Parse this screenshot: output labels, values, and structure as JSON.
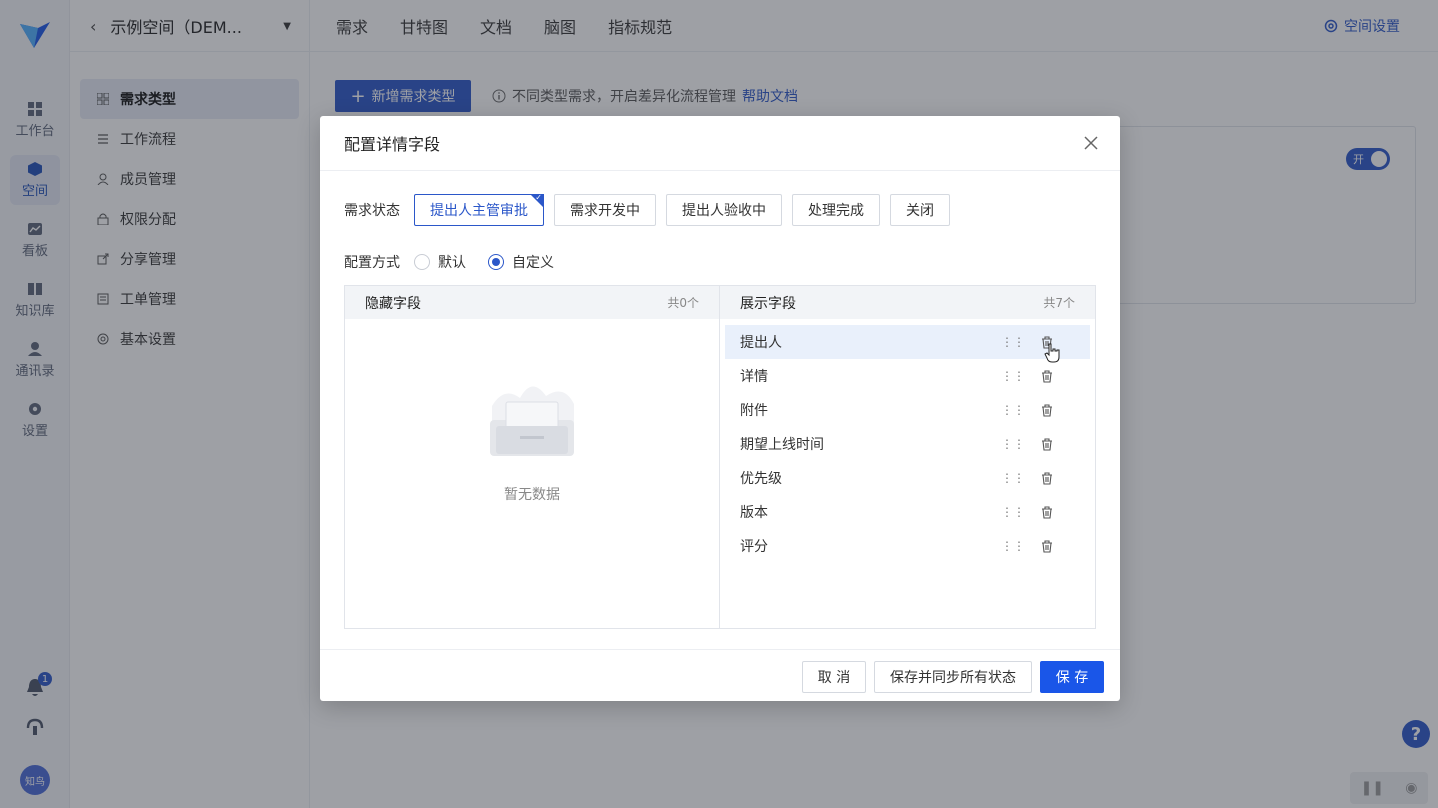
{
  "rail": {
    "items": [
      {
        "label": "工作台",
        "icon": "dashboard-icon"
      },
      {
        "label": "空间",
        "icon": "cube-icon",
        "active": true
      },
      {
        "label": "看板",
        "icon": "chart-icon"
      },
      {
        "label": "知识库",
        "icon": "book-icon"
      },
      {
        "label": "通讯录",
        "icon": "contact-icon"
      },
      {
        "label": "设置",
        "icon": "gear-icon"
      }
    ],
    "notification_count": "1",
    "avatar_text": "知鸟"
  },
  "topbar": {
    "space_name": "示例空间（DEM...",
    "nav": [
      "需求",
      "甘特图",
      "文档",
      "脑图",
      "指标规范"
    ],
    "space_settings": "空间设置"
  },
  "sidebar": {
    "items": [
      {
        "label": "需求类型",
        "icon": "grid-icon",
        "active": true
      },
      {
        "label": "工作流程",
        "icon": "flow-icon"
      },
      {
        "label": "成员管理",
        "icon": "user-icon"
      },
      {
        "label": "权限分配",
        "icon": "lock-icon"
      },
      {
        "label": "分享管理",
        "icon": "share-icon"
      },
      {
        "label": "工单管理",
        "icon": "ticket-icon"
      },
      {
        "label": "基本设置",
        "icon": "gear-icon"
      }
    ]
  },
  "main": {
    "add_button": "新增需求类型",
    "tip_text": "不同类型需求，开启差异化流程管理",
    "tip_link": "帮助文档",
    "toggle_label": "开"
  },
  "modal": {
    "title": "配置详情字段",
    "status_label": "需求状态",
    "statuses": [
      {
        "label": "提出人主管审批",
        "active": true
      },
      {
        "label": "需求开发中"
      },
      {
        "label": "提出人验收中"
      },
      {
        "label": "处理完成"
      },
      {
        "label": "关闭"
      }
    ],
    "mode_label": "配置方式",
    "mode_options": [
      {
        "label": "默认",
        "checked": false
      },
      {
        "label": "自定义",
        "checked": true
      }
    ],
    "hidden_panel": {
      "title": "隐藏字段",
      "count": "共0个",
      "empty_text": "暂无数据"
    },
    "shown_panel": {
      "title": "展示字段",
      "count": "共7个",
      "fields": [
        "提出人",
        "详情",
        "附件",
        "期望上线时间",
        "优先级",
        "版本",
        "评分"
      ]
    },
    "footer": {
      "cancel": "取 消",
      "save_sync": "保存并同步所有状态",
      "save": "保 存"
    }
  },
  "colors": {
    "primary": "#2b57c9",
    "save_button": "#1a56e8"
  }
}
